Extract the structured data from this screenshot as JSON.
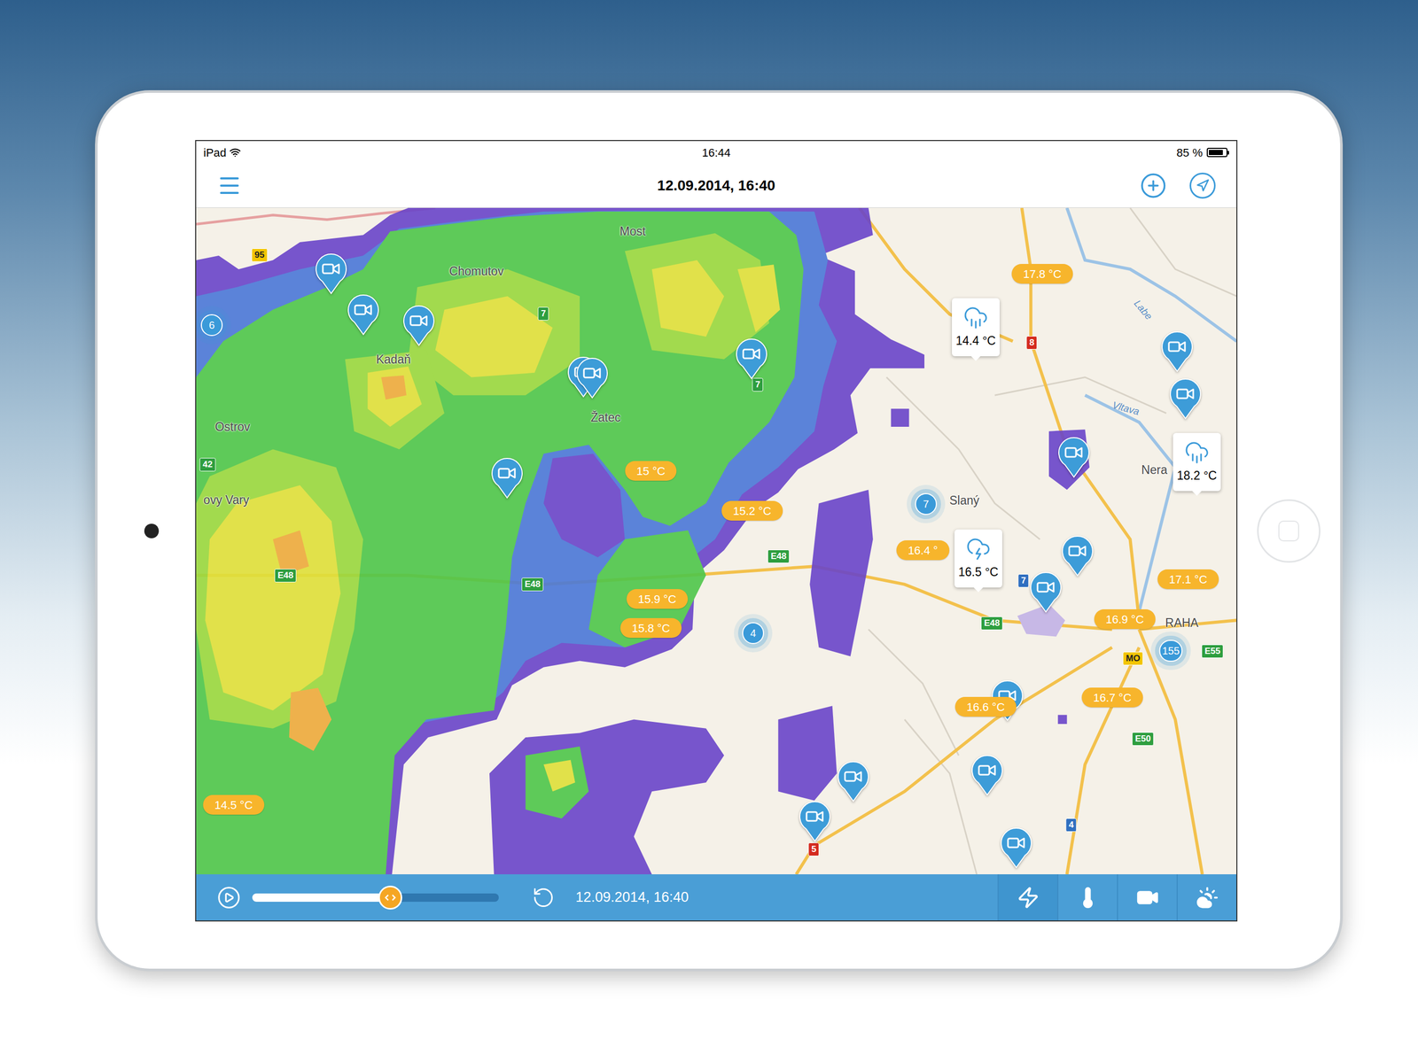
{
  "status_bar": {
    "carrier": "iPad",
    "time": "16:44",
    "battery": {
      "reading": "85 %",
      "level": 0.85
    }
  },
  "nav_bar": {
    "title": "12.09.2014, 16:40"
  },
  "map": {
    "cities": [
      {
        "name": "Most"
      },
      {
        "name": "Chomutov"
      },
      {
        "name": "Kadaň"
      },
      {
        "name": "Žatec"
      },
      {
        "name": "Ostrov"
      },
      {
        "name": "ovy Vary"
      },
      {
        "name": "Slaný"
      },
      {
        "name": "Nera"
      },
      {
        "name": "RAHA"
      }
    ],
    "rivers": [
      {
        "name": "Labe"
      },
      {
        "name": "Vltava"
      }
    ],
    "roads": [
      {
        "label": "95",
        "color": "#f2c500"
      },
      {
        "label": "7",
        "color": "#2e9e3f"
      },
      {
        "label": "7",
        "color": "#2e9e3f"
      },
      {
        "label": "8",
        "color": "#d42a1e"
      },
      {
        "label": "42",
        "color": "#2e9e3f"
      },
      {
        "label": "E48",
        "color": "#2e9e3f"
      },
      {
        "label": "E48",
        "color": "#2e9e3f"
      },
      {
        "label": "E48",
        "color": "#2e9e3f"
      },
      {
        "label": "E48",
        "color": "#2e9e3f"
      },
      {
        "label": "7",
        "color": "#2f6fc0"
      },
      {
        "label": "MO",
        "color": "#f2c500"
      },
      {
        "label": "E55",
        "color": "#2e9e3f"
      },
      {
        "label": "E50",
        "color": "#2e9e3f"
      },
      {
        "label": "5",
        "color": "#d42a1e"
      },
      {
        "label": "4",
        "color": "#2f6fc0"
      }
    ],
    "temperatures": [
      {
        "reading": "17.8 °C"
      },
      {
        "reading": "15 °C"
      },
      {
        "reading": "15.2 °C"
      },
      {
        "reading": "16.4 °"
      },
      {
        "reading": "15.9 °C"
      },
      {
        "reading": "15.8 °C"
      },
      {
        "reading": "17.1 °C"
      },
      {
        "reading": "16.9 °C"
      },
      {
        "reading": "16.6 °C"
      },
      {
        "reading": "16.7 °C"
      },
      {
        "reading": "14.5 °C"
      }
    ],
    "weather_cards": [
      {
        "reading": "14.4 °C",
        "kind": "rain"
      },
      {
        "reading": "16.5 °C",
        "kind": "storm"
      },
      {
        "reading": "18.2 °C",
        "kind": "rain"
      }
    ],
    "clusters": [
      {
        "count": "6"
      },
      {
        "count": "7"
      },
      {
        "count": "4"
      },
      {
        "count": "155"
      }
    ],
    "camera_pins": [
      {
        "kind": "camera"
      },
      {
        "kind": "camera"
      },
      {
        "kind": "camera"
      },
      {
        "kind": "camera"
      },
      {
        "kind": "camera"
      },
      {
        "kind": "camera"
      },
      {
        "kind": "camera"
      },
      {
        "kind": "camera"
      },
      {
        "kind": "camera"
      },
      {
        "kind": "camera"
      },
      {
        "kind": "camera"
      },
      {
        "kind": "camera"
      },
      {
        "kind": "camera"
      },
      {
        "kind": "camera"
      },
      {
        "kind": "camera"
      },
      {
        "kind": "camera"
      },
      {
        "kind": "camera"
      }
    ]
  },
  "timeline": {
    "level": 0.56,
    "time": "12.09.2014, 16:40"
  },
  "layers": [
    {
      "kind": "lightning",
      "selected": false
    },
    {
      "kind": "temperature",
      "selected": true
    },
    {
      "kind": "camera",
      "selected": true
    },
    {
      "kind": "weather",
      "selected": true
    }
  ]
}
